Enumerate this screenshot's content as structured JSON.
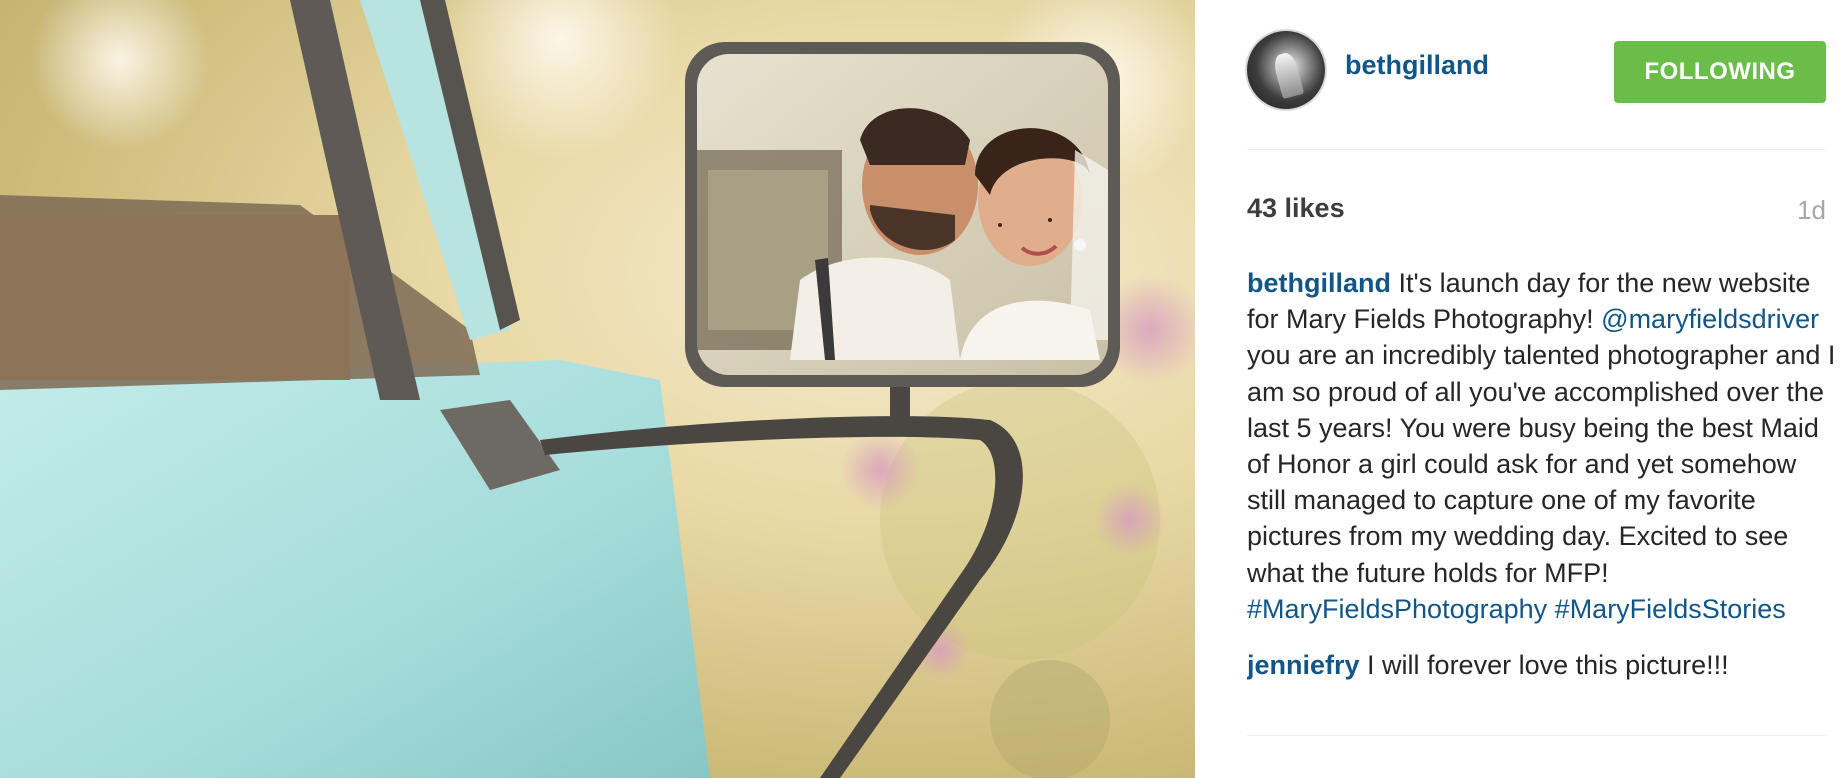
{
  "post": {
    "photo_icon": "wedding-photo-truck-mirror",
    "author": {
      "username": "bethgilland",
      "avatar_icon": "profile-avatar"
    },
    "follow_button_label": "FOLLOWING",
    "likes": "43 likes",
    "time_ago": "1d",
    "caption": {
      "author": "bethgilland",
      "text_1": " It's launch day for the new website for Mary Fields Photography! ",
      "mention": "@maryfieldsdriver",
      "text_2": " you are an incredibly talented photographer and I am so proud of all you've accomplished over the last 5 years! You were busy being the best Maid of Honor a girl could ask for and yet somehow still managed to capture one of my favorite pictures from my wedding day. Excited to see what the future holds for MFP! ",
      "hashtag_1": "#MaryFieldsPhotography",
      "hashtag_2": "#MaryFieldsStories"
    },
    "comments": [
      {
        "author": "jenniefry",
        "text": " I will forever love this picture!!!"
      }
    ]
  },
  "colors": {
    "link": "#125688",
    "follow_button": "#6bbd4a",
    "timestamp": "#a5a7aa"
  }
}
